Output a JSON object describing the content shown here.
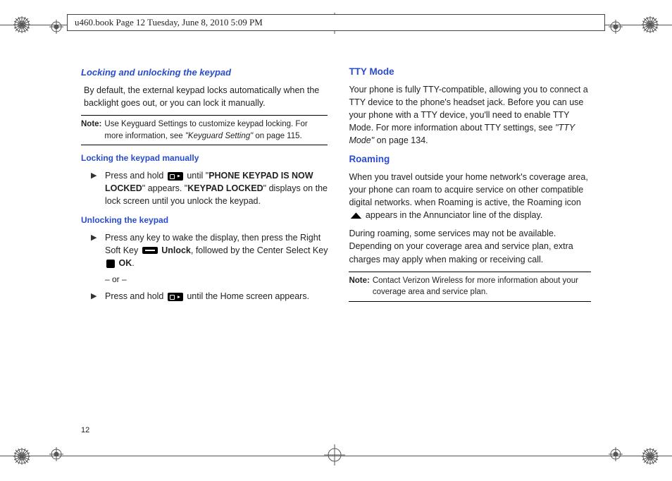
{
  "header": "u460.book  Page 12  Tuesday, June 8, 2010  5:09 PM",
  "page_number": "12",
  "left": {
    "h1": "Locking and unlocking the keypad",
    "intro": "By default, the external keypad locks automatically when the backlight goes out, or you can lock it manually.",
    "note_label": "Note:",
    "note_body_a": "Use Keyguard Settings to customize keypad locking. For more information, see ",
    "note_ref": "\"Keyguard Setting\"",
    "note_body_b": " on page 115.",
    "h2a": "Locking the keypad manually",
    "b1_pre": "Press and hold ",
    "b1_mid_a": " until \"",
    "b1_bold_a": "PHONE KEYPAD IS NOW LOCKED",
    "b1_mid_b": "\" appears.  \"",
    "b1_bold_b": "KEYPAD LOCKED",
    "b1_post": "\" displays on the lock screen until you unlock the keypad.",
    "h2b": "Unlocking the keypad",
    "b2_a": "Press any key to wake the display, then press the Right Soft Key ",
    "b2_unlock": " Unlock",
    "b2_b": ", followed by the Center Select Key ",
    "b2_ok": " OK",
    "b2_c": ".",
    "or": "– or –",
    "b3_a": "Press and hold ",
    "b3_b": " until the Home screen appears."
  },
  "right": {
    "h1": "TTY Mode",
    "p1_a": "Your phone is fully TTY-compatible, allowing you to connect a TTY device to the phone's headset jack. Before you can use your phone with a TTY device, you'll need to enable TTY Mode. For more information about TTY settings, see ",
    "p1_ref": "\"TTY Mode\"",
    "p1_b": " on page 134.",
    "h2": "Roaming",
    "p2_a": "When you travel outside your home network's coverage area, your phone can roam to acquire service on other compatible digital networks. when Roaming is active, the Roaming icon ",
    "p2_b": " appears in the Annunciator line of the display.",
    "p3": "During roaming, some services may not be available. Depending on your coverage area and service plan, extra charges may apply when making or receiving call.",
    "note_label": "Note:",
    "note_body": "Contact Verizon Wireless for more information about your coverage area and service plan."
  }
}
